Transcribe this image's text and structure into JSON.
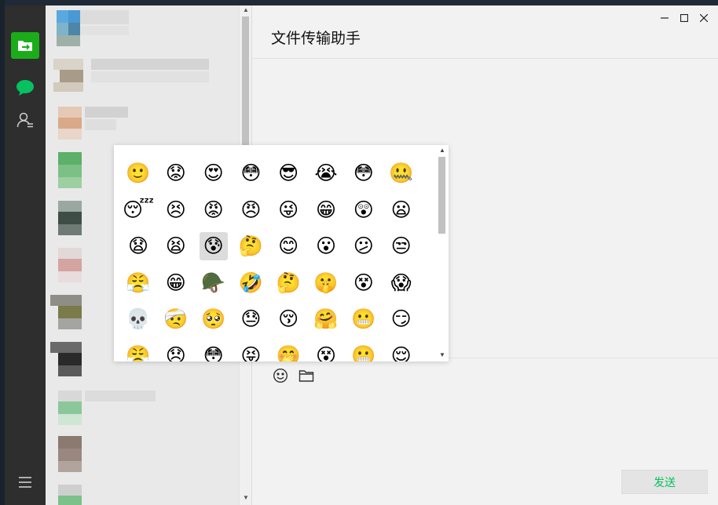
{
  "window": {
    "title": "文件传输助手",
    "controls": {
      "minimize": "—",
      "maximize": "□",
      "close": "✕"
    }
  },
  "nav": {
    "items": [
      {
        "id": "file-transfer",
        "icon": "folder-arrow-icon",
        "color": "#1aad19"
      },
      {
        "id": "chats",
        "icon": "chat-bubble-icon",
        "color": "#07c160"
      },
      {
        "id": "contacts",
        "icon": "contacts-icon",
        "color": "#cccccc"
      }
    ],
    "menu_icon": "hamburger-menu-icon"
  },
  "toolbar": {
    "emoji_icon": "smiley-icon",
    "file_icon": "folder-icon",
    "send_label": "发送"
  },
  "emoji_panel": {
    "selected_index": 18,
    "rows": [
      [
        "🙂",
        "😟",
        "😍",
        "😳",
        "😎",
        "😭",
        "😳",
        "🤐"
      ],
      [
        "😴",
        "😣",
        "😡",
        "😠",
        "😜",
        "😁",
        "😲",
        "😦"
      ],
      [
        "😧",
        "😫",
        "😰",
        "🤔",
        "😊",
        "😮",
        "😕",
        "😒"
      ],
      [
        "😤",
        "😁",
        "🪖",
        "🤣",
        "🤔",
        "🤫",
        "😵",
        "😱"
      ],
      [
        "💀",
        "🤕",
        "🥺",
        "😓",
        "😚",
        "🤗",
        "😬",
        "😏"
      ],
      [
        "😤",
        "😞",
        "😳",
        "😝",
        "🤭",
        "😵",
        "😬",
        "😌"
      ]
    ]
  },
  "colors": {
    "nav_bg": "#2e2e2e",
    "list_bg": "#e9e9e9",
    "main_bg": "#f2f2f2",
    "send_text": "#07c160",
    "accent_green": "#1aad19"
  }
}
